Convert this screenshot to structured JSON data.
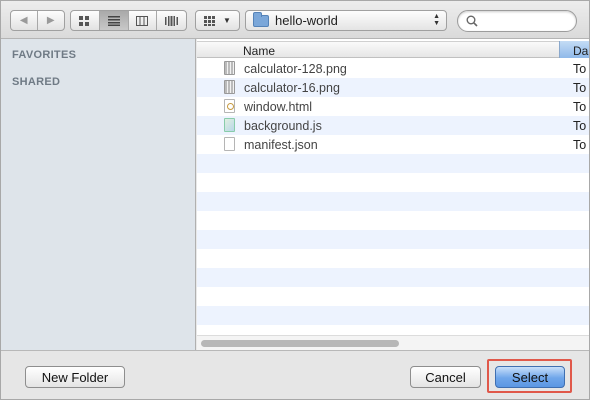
{
  "toolbar": {
    "back_icon": "chevron-left-icon",
    "forward_icon": "chevron-right-icon",
    "view_modes": [
      "icon-view",
      "list-view",
      "column-view",
      "coverflow-view"
    ],
    "active_view": "list-view",
    "location": "hello-world",
    "search": {
      "value": "",
      "placeholder": ""
    }
  },
  "sidebar": {
    "sections": [
      "FAVORITES",
      "SHARED"
    ]
  },
  "file_list": {
    "columns": {
      "name": "Name",
      "date": "Da"
    },
    "files": [
      {
        "name": "calculator-128.png",
        "date": "To",
        "icon": "image-file-icon"
      },
      {
        "name": "calculator-16.png",
        "date": "To",
        "icon": "image-file-icon"
      },
      {
        "name": "window.html",
        "date": "To",
        "icon": "html-file-icon"
      },
      {
        "name": "background.js",
        "date": "To",
        "icon": "js-file-icon"
      },
      {
        "name": "manifest.json",
        "date": "To",
        "icon": "document-file-icon"
      }
    ]
  },
  "footer": {
    "new_folder_label": "New Folder",
    "cancel_label": "Cancel",
    "select_label": "Select"
  },
  "colors": {
    "sidebar_bg": "#dee4ea",
    "row_alt": "#edf3fe",
    "select_button": "#6fa6ea",
    "highlight": "#e0584a"
  }
}
